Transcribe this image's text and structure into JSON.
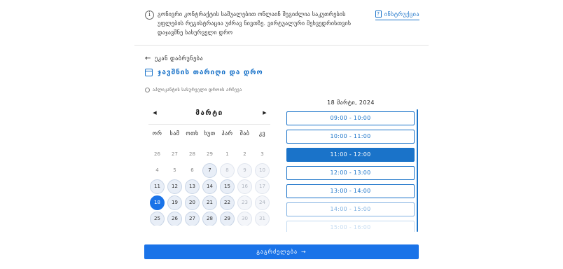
{
  "notice": {
    "icon": "info-icon",
    "text": "გონივრი კონტრაქტის საშუალებით ონლაინ შეგიძლია საკუთრების უფლების რეგისტრაცია უძრავ ნივთზე. ვირტუალური შეხვედრისთვის დაჯავშნე სასურველი დრო",
    "instructions_label": "ინსტრუქცია"
  },
  "back_label": "უკან დაბრუნება",
  "section_title": "ჯავშნის თარიღი და დრო",
  "tz_note": "აპლიკანტის სასურველი დროის არჩევა",
  "calendar": {
    "month": "მარტი",
    "weekdays": [
      "ორ",
      "სამ",
      "ოთხ",
      "ხუთ",
      "პარ",
      "შაბ",
      "კვ"
    ],
    "days": [
      {
        "label": "26",
        "state": "prev"
      },
      {
        "label": "27",
        "state": "prev"
      },
      {
        "label": "28",
        "state": "prev"
      },
      {
        "label": "29",
        "state": "prev"
      },
      {
        "label": "1",
        "state": "prev"
      },
      {
        "label": "2",
        "state": "prev"
      },
      {
        "label": "3",
        "state": "prev"
      },
      {
        "label": "4",
        "state": "prev"
      },
      {
        "label": "5",
        "state": "prev"
      },
      {
        "label": "6",
        "state": "prev"
      },
      {
        "label": "7",
        "state": "avail"
      },
      {
        "label": "8",
        "state": "out"
      },
      {
        "label": "9",
        "state": "out"
      },
      {
        "label": "10",
        "state": "out"
      },
      {
        "label": "11",
        "state": "avail"
      },
      {
        "label": "12",
        "state": "avail"
      },
      {
        "label": "13",
        "state": "avail"
      },
      {
        "label": "14",
        "state": "avail"
      },
      {
        "label": "15",
        "state": "avail"
      },
      {
        "label": "16",
        "state": "out"
      },
      {
        "label": "17",
        "state": "out"
      },
      {
        "label": "18",
        "state": "sel"
      },
      {
        "label": "19",
        "state": "avail"
      },
      {
        "label": "20",
        "state": "avail"
      },
      {
        "label": "21",
        "state": "avail"
      },
      {
        "label": "22",
        "state": "avail"
      },
      {
        "label": "23",
        "state": "out"
      },
      {
        "label": "24",
        "state": "out"
      },
      {
        "label": "25",
        "state": "avail"
      },
      {
        "label": "26",
        "state": "avail"
      },
      {
        "label": "27",
        "state": "avail"
      },
      {
        "label": "28",
        "state": "avail"
      },
      {
        "label": "29",
        "state": "avail"
      },
      {
        "label": "30",
        "state": "out"
      },
      {
        "label": "31",
        "state": "out"
      }
    ]
  },
  "slots_date": "18 მარტი, 2024",
  "slots": [
    {
      "label": "09:00 - 10:00",
      "state": "normal"
    },
    {
      "label": "10:00 - 11:00",
      "state": "normal"
    },
    {
      "label": "11:00 - 12:00",
      "state": "sel"
    },
    {
      "label": "12:00 - 13:00",
      "state": "normal"
    },
    {
      "label": "13:00 - 14:00",
      "state": "normal"
    },
    {
      "label": "14:00 - 15:00",
      "state": "faded"
    },
    {
      "label": "15:00 - 16:00",
      "state": "fade2"
    }
  ],
  "continue_label": "გაგრძელება",
  "colors": {
    "accent": "#1a73c9",
    "selected": "#1a73e8"
  }
}
